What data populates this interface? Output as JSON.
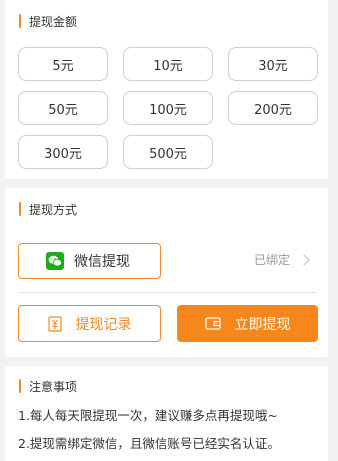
{
  "amount_section": {
    "title": "提现金额",
    "options": [
      "5元",
      "10元",
      "30元",
      "50元",
      "100元",
      "200元",
      "300元",
      "500元"
    ]
  },
  "method_section": {
    "title": "提现方式",
    "method_label": "微信提现",
    "method_icon": "wechat-icon",
    "bound_status": "已绑定",
    "record_button": "提现记录",
    "withdraw_button": "立即提现"
  },
  "notes_section": {
    "title": "注意事项",
    "items": [
      "1.每人每天限提现一次，建议赚多点再提现哦~",
      "2.提现需绑定微信，且微信账号已经实名认证。"
    ]
  },
  "colors": {
    "accent": "#f08a2a",
    "primary_button": "#f7861b",
    "wechat_green": "#1aad19"
  }
}
